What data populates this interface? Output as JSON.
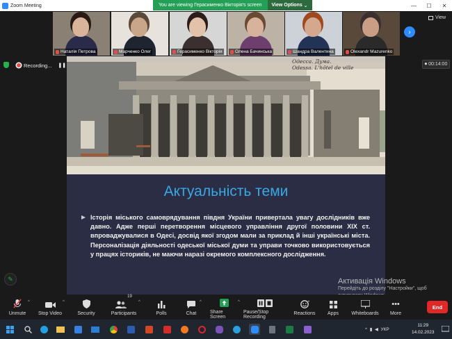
{
  "window": {
    "title": "Zoom Meeting"
  },
  "share_banner": {
    "message": "You are viewing Герасименко Вікторія's screen",
    "view_options": "View Options"
  },
  "participants": [
    {
      "name": "Наталія Петрова",
      "skin": "#d9b49a",
      "hair": "#2a1a14",
      "shirt": "#2a2a4a",
      "bg": "#8a8174"
    },
    {
      "name": "Марченко Олег",
      "skin": "#c9a58a",
      "hair": "#5a4a3a",
      "shirt": "#1f2530",
      "bg": "#e7e3dc"
    },
    {
      "name": "Герасименко Вікторія",
      "skin": "#e2c2ab",
      "hair": "#2b1d18",
      "shirt": "#3c2f2f",
      "bg": "#d6d6d6"
    },
    {
      "name": "Олена Бачинська",
      "skin": "#d7b39e",
      "hair": "#6a4a33",
      "shirt": "#6d3e6e",
      "bg": "#bcb2a6"
    },
    {
      "name": "Шандра Валентина",
      "skin": "#d3a88f",
      "hair": "#a0481e",
      "shirt": "#223355",
      "bg": "#ccd2d8"
    },
    {
      "name": "Olexandr Mazurenko",
      "skin": "#c99e84",
      "hair": "#3a3030",
      "shirt": "#2a2a2a",
      "bg": "#58493b"
    }
  ],
  "view_label": "View",
  "recording": {
    "label": "Recording...",
    "pause": "❚❚",
    "stop": "■"
  },
  "timer": "00:14:00",
  "slide": {
    "photo_caption_line1": "Одесса. Дума.",
    "photo_caption_line2": "Odessa. L'hôtel de ville",
    "title": "Актуальність теми",
    "body": "Історія міського самоврядування півдня України привертала увагу дослідників вже давно. Адже перші перетворення місцевого управління другої половини ХІХ ст. впроваджувалися в Одесі, досвід якої згодом мали за приклад й інші українські міста. Персоналізація діяльності одеської міської думи та управи точково використовується у працях істориків, не маючи наразі окремого комплексного дослідження."
  },
  "toolbar": {
    "unmute": "Unmute",
    "stop_video": "Stop Video",
    "security": "Security",
    "participants": "Participants",
    "participants_count": "19",
    "polls": "Polls",
    "chat": "Chat",
    "share_screen": "Share Screen",
    "pause_recording": "Pause/Stop Recording",
    "reactions": "Reactions",
    "apps": "Apps",
    "whiteboards": "Whiteboards",
    "more": "More",
    "end": "End"
  },
  "activation": {
    "line1": "Активація Windows",
    "line2": "Перейдіть до розділу \"Настройки\", щоб",
    "line3": "активувати Windows."
  },
  "taskbar": {
    "language": "УКР",
    "time": "11:29",
    "date": "14.02.2023"
  },
  "colors": {
    "accent": "#2d8cff",
    "share_green": "#23a055",
    "end_red": "#e02828",
    "title_blue": "#39a8e6"
  }
}
